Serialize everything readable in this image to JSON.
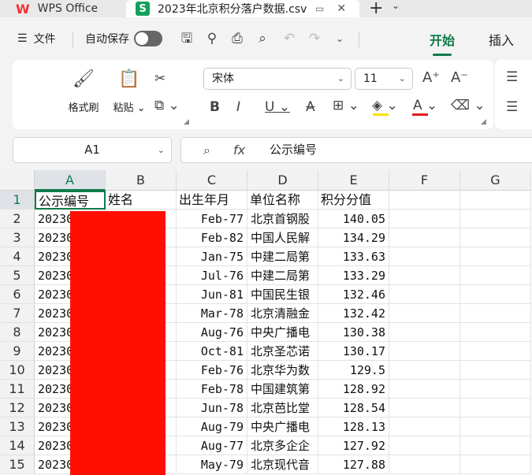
{
  "titlebar": {
    "app_tab": "WPS Office",
    "doc_tab": "2023年北京积分落户数据.csv",
    "close_glyph": "✕",
    "new_tab_glyph": "+",
    "menu_glyph": "⌄"
  },
  "quickbar": {
    "file_menu": "文件",
    "autosave_label": "自动保存",
    "tab_home": "开始",
    "tab_insert": "插入"
  },
  "ribbon": {
    "format_painter": "格式刷",
    "paste": "粘贴",
    "font_name": "宋体",
    "font_size": "11"
  },
  "formula": {
    "cell_ref": "A1",
    "fx_label": "fx",
    "content": "公示编号"
  },
  "columns": [
    "A",
    "B",
    "C",
    "D",
    "E",
    "F",
    "G"
  ],
  "rows": [
    "1",
    "2",
    "3",
    "4",
    "5",
    "6",
    "7",
    "8",
    "9",
    "10",
    "11",
    "12",
    "13",
    "14",
    "15"
  ],
  "headers": [
    "公示编号",
    "姓名",
    "出生年月",
    "单位名称",
    "积分分值"
  ],
  "records": [
    {
      "id": "20230",
      "birth": "Feb-77",
      "unit": "北京首钢股",
      "score": "140.05"
    },
    {
      "id": "20230",
      "birth": "Feb-82",
      "unit": "中国人民解",
      "score": "134.29"
    },
    {
      "id": "20230",
      "birth": "Jan-75",
      "unit": "中建二局第",
      "score": "133.63"
    },
    {
      "id": "20230",
      "birth": "Jul-76",
      "unit": "中建二局第",
      "score": "133.29"
    },
    {
      "id": "20230",
      "birth": "Jun-81",
      "unit": "中国民生银",
      "score": "132.46"
    },
    {
      "id": "20230",
      "birth": "Mar-78",
      "unit": "北京清融金",
      "score": "132.42"
    },
    {
      "id": "20230",
      "birth": "Aug-76",
      "unit": "中央广播电",
      "score": "130.38"
    },
    {
      "id": "20230",
      "birth": "Oct-81",
      "unit": "北京圣芯诺",
      "score": "130.17"
    },
    {
      "id": "20230",
      "birth": "Feb-76",
      "unit": "北京华为数",
      "score": "129.5"
    },
    {
      "id": "20230",
      "birth": "Feb-78",
      "unit": "中国建筑第",
      "score": "128.92"
    },
    {
      "id": "20230",
      "birth": "Jun-78",
      "unit": "北京芭比堂",
      "score": "128.54"
    },
    {
      "id": "20230",
      "birth": "Aug-79",
      "unit": "中央广播电",
      "score": "128.13"
    },
    {
      "id": "20230",
      "birth": "Aug-77",
      "unit": "北京多企企",
      "score": "127.92"
    },
    {
      "id": "20230",
      "birth": "May-79",
      "unit": "北京现代音",
      "score": "127.88"
    }
  ],
  "colors": {
    "accent": "#0f7b4a",
    "redaction": "#ff0f00",
    "wps_red": "#e33333"
  }
}
